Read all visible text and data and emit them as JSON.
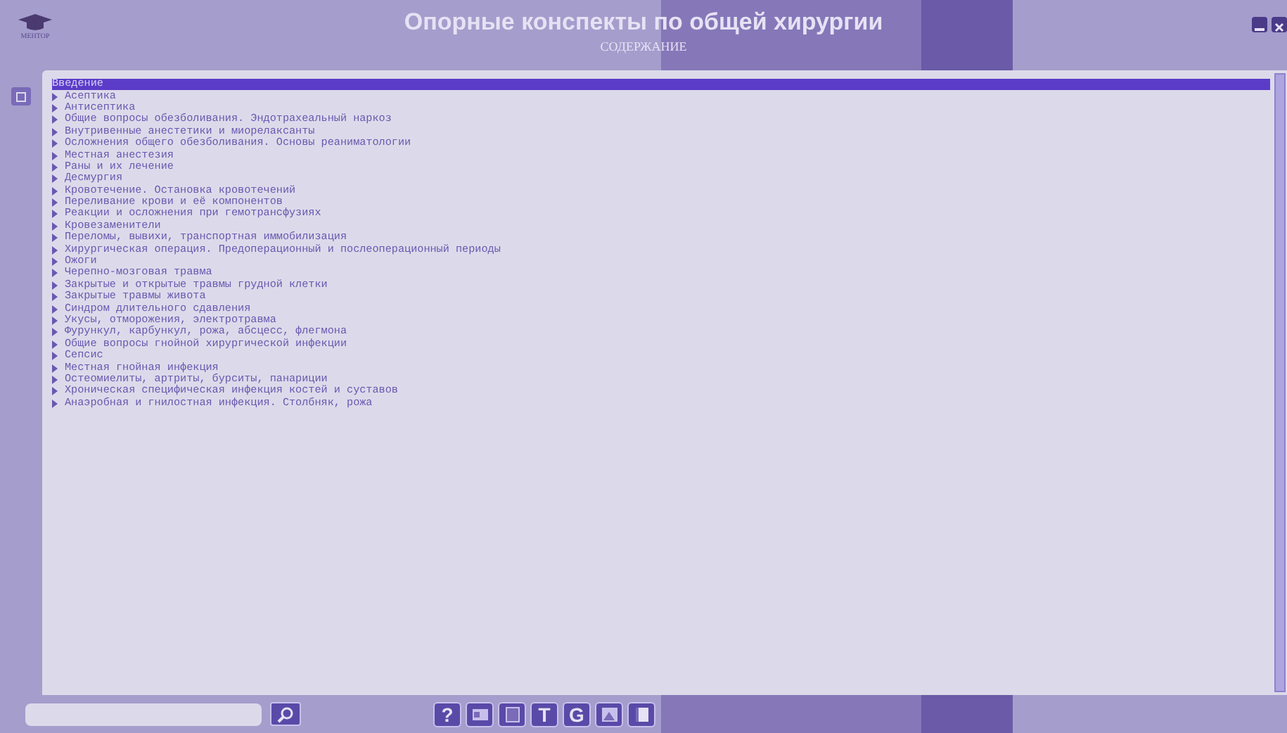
{
  "header": {
    "logo_text": "МЕНТОР",
    "title": "Опорные конспекты по общей хирургии",
    "subtitle": "СОДЕРЖАНИЕ"
  },
  "contents": [
    {
      "label": "Введение",
      "selected": true
    },
    {
      "label": "Асептика",
      "selected": false
    },
    {
      "label": "Антисептика",
      "selected": false
    },
    {
      "label": "Общие вопросы обезболивания. Эндотрахеальный наркоз",
      "selected": false
    },
    {
      "label": "Внутривенные анестетики и миорелаксанты",
      "selected": false
    },
    {
      "label": "Осложнения общего обезболивания. Основы реаниматологии",
      "selected": false
    },
    {
      "label": "Местная анестезия",
      "selected": false
    },
    {
      "label": "Раны и их лечение",
      "selected": false
    },
    {
      "label": "Десмургия",
      "selected": false
    },
    {
      "label": "Кровотечение. Остановка кровотечений",
      "selected": false
    },
    {
      "label": "Переливание крови и её компонентов",
      "selected": false
    },
    {
      "label": "Реакции и осложнения при гемотрансфузиях",
      "selected": false
    },
    {
      "label": "Кровезаменители",
      "selected": false
    },
    {
      "label": "Переломы, вывихи, транспортная иммобилизация",
      "selected": false
    },
    {
      "label": "Хирургическая операция. Предоперационный и послеоперационный периоды",
      "selected": false
    },
    {
      "label": "Ожоги",
      "selected": false
    },
    {
      "label": "Черепно-мозговая травма",
      "selected": false
    },
    {
      "label": "Закрытые и открытые травмы грудной клетки",
      "selected": false
    },
    {
      "label": "Закрытые травмы живота",
      "selected": false
    },
    {
      "label": "Синдром длительного сдавления",
      "selected": false
    },
    {
      "label": "Укусы, отморожения, электротравма",
      "selected": false
    },
    {
      "label": "Фурункул, карбункул, рожа, абсцесс, флегмона",
      "selected": false
    },
    {
      "label": "Общие вопросы гнойной хирургической инфекции",
      "selected": false
    },
    {
      "label": "Сепсис",
      "selected": false
    },
    {
      "label": "Местная гнойная инфекция",
      "selected": false
    },
    {
      "label": "Остеомиелиты, артриты, бурситы, панариции",
      "selected": false
    },
    {
      "label": "Хроническая специфическая инфекция костей и суставов",
      "selected": false
    },
    {
      "label": "Анаэробная и гнилостная инфекция. Столбняк, рожа",
      "selected": false
    }
  ],
  "toolbar": [
    {
      "kind": "help",
      "label": "?"
    },
    {
      "kind": "card"
    },
    {
      "kind": "doc"
    },
    {
      "kind": "letter",
      "label": "T"
    },
    {
      "kind": "letter",
      "label": "G"
    },
    {
      "kind": "image"
    },
    {
      "kind": "book"
    }
  ]
}
